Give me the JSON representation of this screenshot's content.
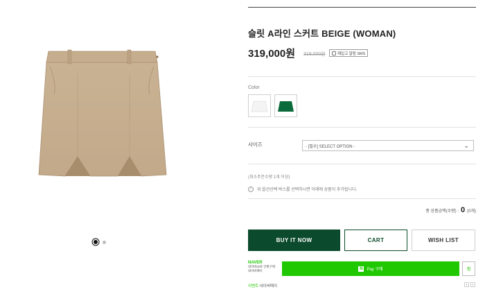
{
  "product": {
    "title": "슬릿 A라인 스커트 BEIGE (WOMAN)",
    "price": "319,000원",
    "original_price": "319,000원",
    "alert_button": "재입고 알림 SMS"
  },
  "gallery": {
    "image": "skirt-beige",
    "dots": [
      {
        "active": true
      },
      {
        "active": false
      }
    ]
  },
  "color": {
    "label": "Color",
    "options": [
      {
        "name": "white",
        "color": "#f4f4f4"
      },
      {
        "name": "green",
        "color": "#0c6b3a"
      }
    ]
  },
  "size": {
    "label": "사이즈",
    "selected": "- [필수] SELECT OPTION -"
  },
  "min_qty": "(최소주문수량 1개 이상)",
  "notice": "위 옵션선택 박스를 선택하시면 아래에 상품이 추가됩니다.",
  "total": {
    "label": "총 상품금액(수량) :",
    "amount": "0",
    "count": "(0개)"
  },
  "buttons": {
    "buy": "BUY IT NOW",
    "cart": "CART",
    "wish": "WISH LIST"
  },
  "naver": {
    "logo": "NAVER",
    "line1": "네이버ID로 간편구매",
    "line2": "네이버페이",
    "pay_label": "Pay 구매",
    "zzim": "찜",
    "event_prefix": "이벤트",
    "event_label": "네이버페이"
  },
  "colors": {
    "accent": "#0b4a2c",
    "naver_green": "#1fc800",
    "skirt_beige": "#c8b092"
  }
}
